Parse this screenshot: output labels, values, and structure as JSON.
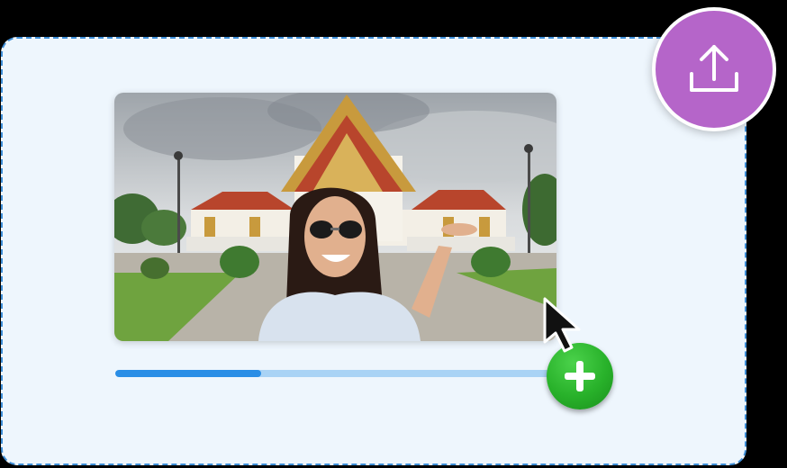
{
  "dropzone": {
    "state": "dragging-file"
  },
  "media": {
    "kind": "photo",
    "subject": "selfie-in-front-of-temple"
  },
  "upload": {
    "progress_fraction": 0.33
  },
  "icons": {
    "upload": "upload-icon",
    "add": "plus-icon",
    "cursor": "arrow-cursor-icon"
  },
  "colors": {
    "dropzone_bg": "#eef6fd",
    "dropzone_border": "#3f8fd8",
    "upload_button": "#b565c9",
    "add_button": "#28b12a",
    "progress_fill": "#2a8ee6",
    "progress_track": "#a9d3f5"
  }
}
